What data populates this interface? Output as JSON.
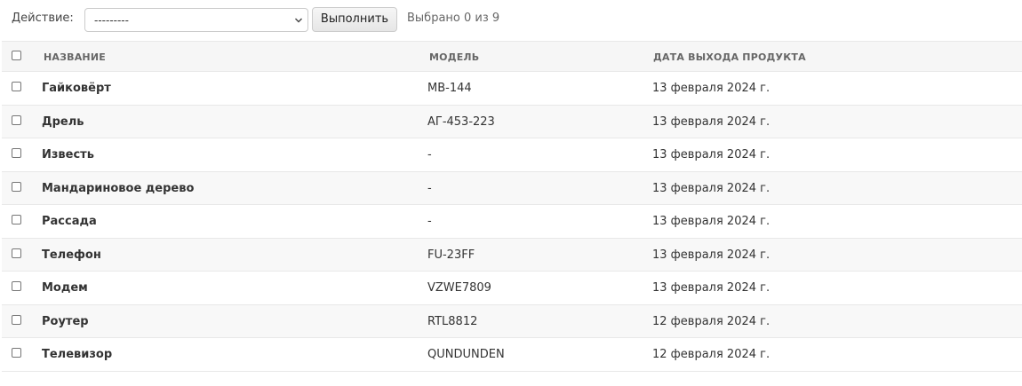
{
  "actions": {
    "label": "Действие:",
    "select_value": "---------",
    "run_label": "Выполнить",
    "selected_text": "Выбрано 0 из 9"
  },
  "table": {
    "headers": {
      "name": "НАЗВАНИЕ",
      "model": "МОДЕЛЬ",
      "date": "ДАТА ВЫХОДА ПРОДУКТА"
    },
    "rows": [
      {
        "name": "Гайковёрт",
        "model": "MB-144",
        "date": "13 февраля 2024 г."
      },
      {
        "name": "Дрель",
        "model": "АГ-453-223",
        "date": "13 февраля 2024 г."
      },
      {
        "name": "Известь",
        "model": "-",
        "date": "13 февраля 2024 г."
      },
      {
        "name": "Мандариновое дерево",
        "model": "-",
        "date": "13 февраля 2024 г."
      },
      {
        "name": "Рассада",
        "model": "-",
        "date": "13 февраля 2024 г."
      },
      {
        "name": "Телефон",
        "model": "FU-23FF",
        "date": "13 февраля 2024 г."
      },
      {
        "name": "Модем",
        "model": "VZWE7809",
        "date": "13 февраля 2024 г."
      },
      {
        "name": "Роутер",
        "model": "RTL8812",
        "date": "12 февраля 2024 г."
      },
      {
        "name": "Телевизор",
        "model": "QUNDUNDEN",
        "date": "12 февраля 2024 г."
      }
    ]
  }
}
